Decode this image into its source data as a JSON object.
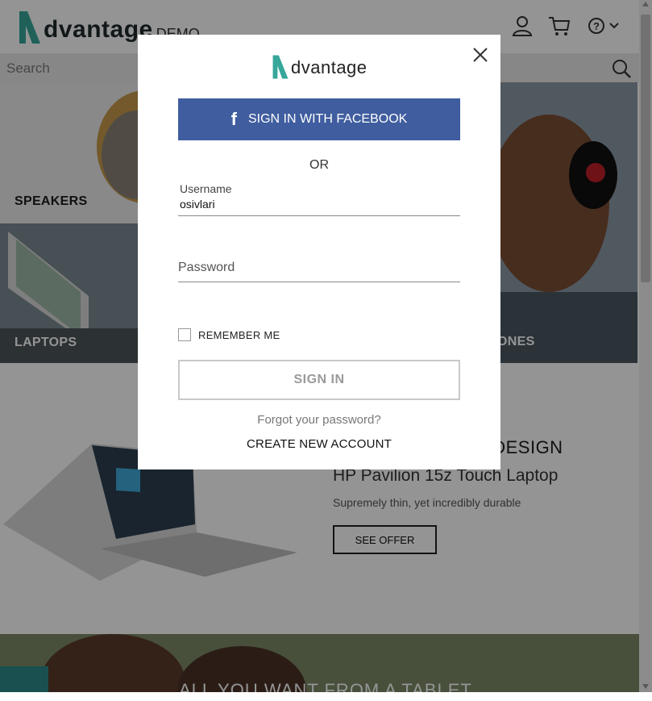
{
  "header": {
    "logo_word": "dvantage",
    "logo_demo": "DEMO",
    "icons": [
      "user-icon",
      "cart-icon",
      "help-icon",
      "chevron-down-icon"
    ]
  },
  "search": {
    "placeholder": "Search"
  },
  "categories": {
    "speakers": "SPEAKERS",
    "laptops": "LAPTOPS",
    "headphones": "ONES"
  },
  "promo": {
    "title": "/ DESIGN",
    "subtitle": "HP Pavilion 15z Touch Laptop",
    "description": "Supremely thin, yet incredibly durable",
    "cta": "SEE OFFER"
  },
  "banner": {
    "text": "ALL YOU WANT FROM A TABLET"
  },
  "modal": {
    "logo_word": "dvantage",
    "facebook_label": "SIGN IN WITH FACEBOOK",
    "or_text": "OR",
    "username_label": "Username",
    "username_value": "osivlari",
    "password_placeholder": "Password",
    "remember_label": "REMEMBER ME",
    "signin_label": "SIGN IN",
    "forgot_label": "Forgot your password?",
    "create_label": "CREATE NEW ACCOUNT"
  },
  "colors": {
    "brand_teal": "#36a79a",
    "facebook_blue": "#3f5d9f"
  }
}
